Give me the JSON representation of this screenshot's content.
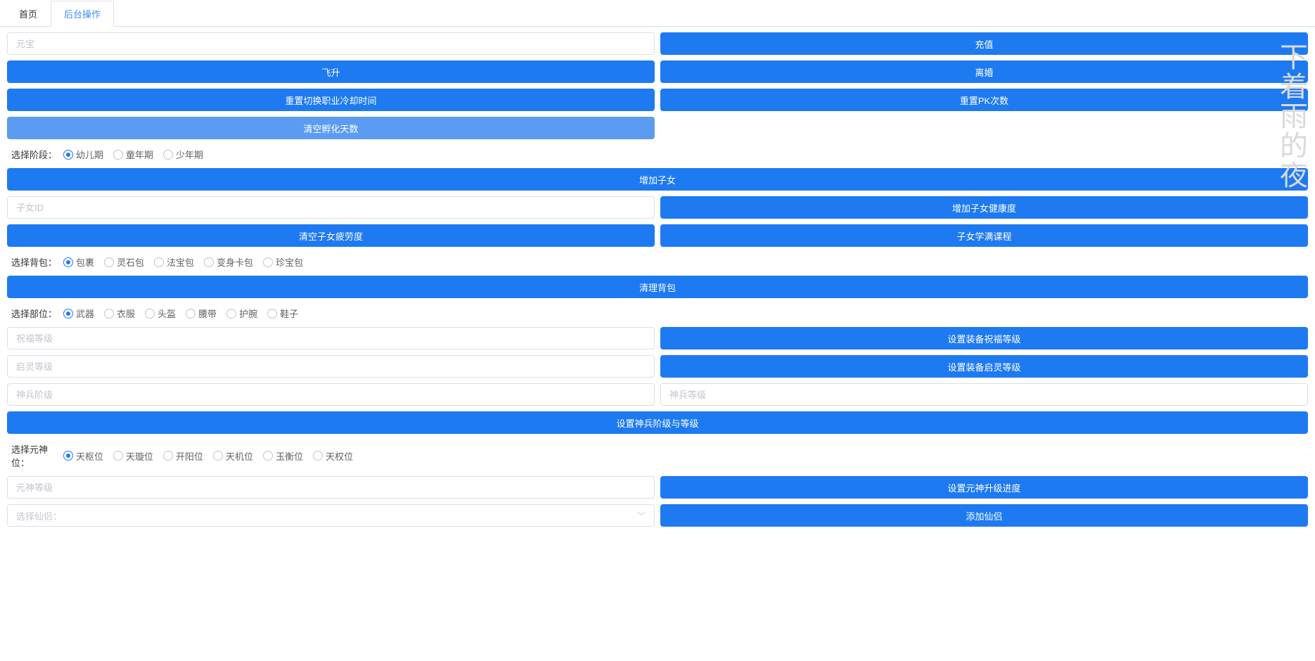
{
  "tabs": [
    "首页",
    "后台操作"
  ],
  "activeTab": 1,
  "watermark": "下着雨的夜",
  "inputs": {
    "yuanbao": "元宝",
    "childId": "子女ID",
    "blessLevel": "祝福等级",
    "qilingLevel": "启灵等级",
    "shenbingStage": "神兵阶级",
    "shenbingLevel": "神兵等级",
    "yuanshenLevel": "元神等级",
    "selectXianlv": "选择仙侣："
  },
  "buttons": {
    "recharge": "充值",
    "ascend": "飞升",
    "divorce": "离婚",
    "resetJobCooldown": "重置切换职业冷却时间",
    "resetPk": "重置PK次数",
    "clearHatchDays": "清空孵化天数",
    "addChild": "增加子女",
    "addChildHealth": "增加子女健康度",
    "clearChildFatigue": "清空子女疲劳度",
    "childFullCourse": "子女学满课程",
    "clearBag": "清理背包",
    "setEquipBless": "设置装备祝福等级",
    "setEquipQiling": "设置装备启灵等级",
    "setShenbing": "设置神兵阶级与等级",
    "setYuanshen": "设置元神升级进度",
    "addXianlv": "添加仙侣"
  },
  "radios": {
    "stage": {
      "label": "选择阶段：",
      "options": [
        "幼儿期",
        "童年期",
        "少年期"
      ],
      "selected": 0
    },
    "bag": {
      "label": "选择背包：",
      "options": [
        "包裹",
        "灵石包",
        "法宝包",
        "变身卡包",
        "珍宝包"
      ],
      "selected": 0
    },
    "part": {
      "label": "选择部位：",
      "options": [
        "武器",
        "衣服",
        "头盔",
        "腰带",
        "护腕",
        "鞋子"
      ],
      "selected": 0
    },
    "yuanshen": {
      "label": "选择元神位：",
      "options": [
        "天枢位",
        "天璇位",
        "开阳位",
        "天机位",
        "玉衡位",
        "天权位"
      ],
      "selected": 0
    }
  }
}
